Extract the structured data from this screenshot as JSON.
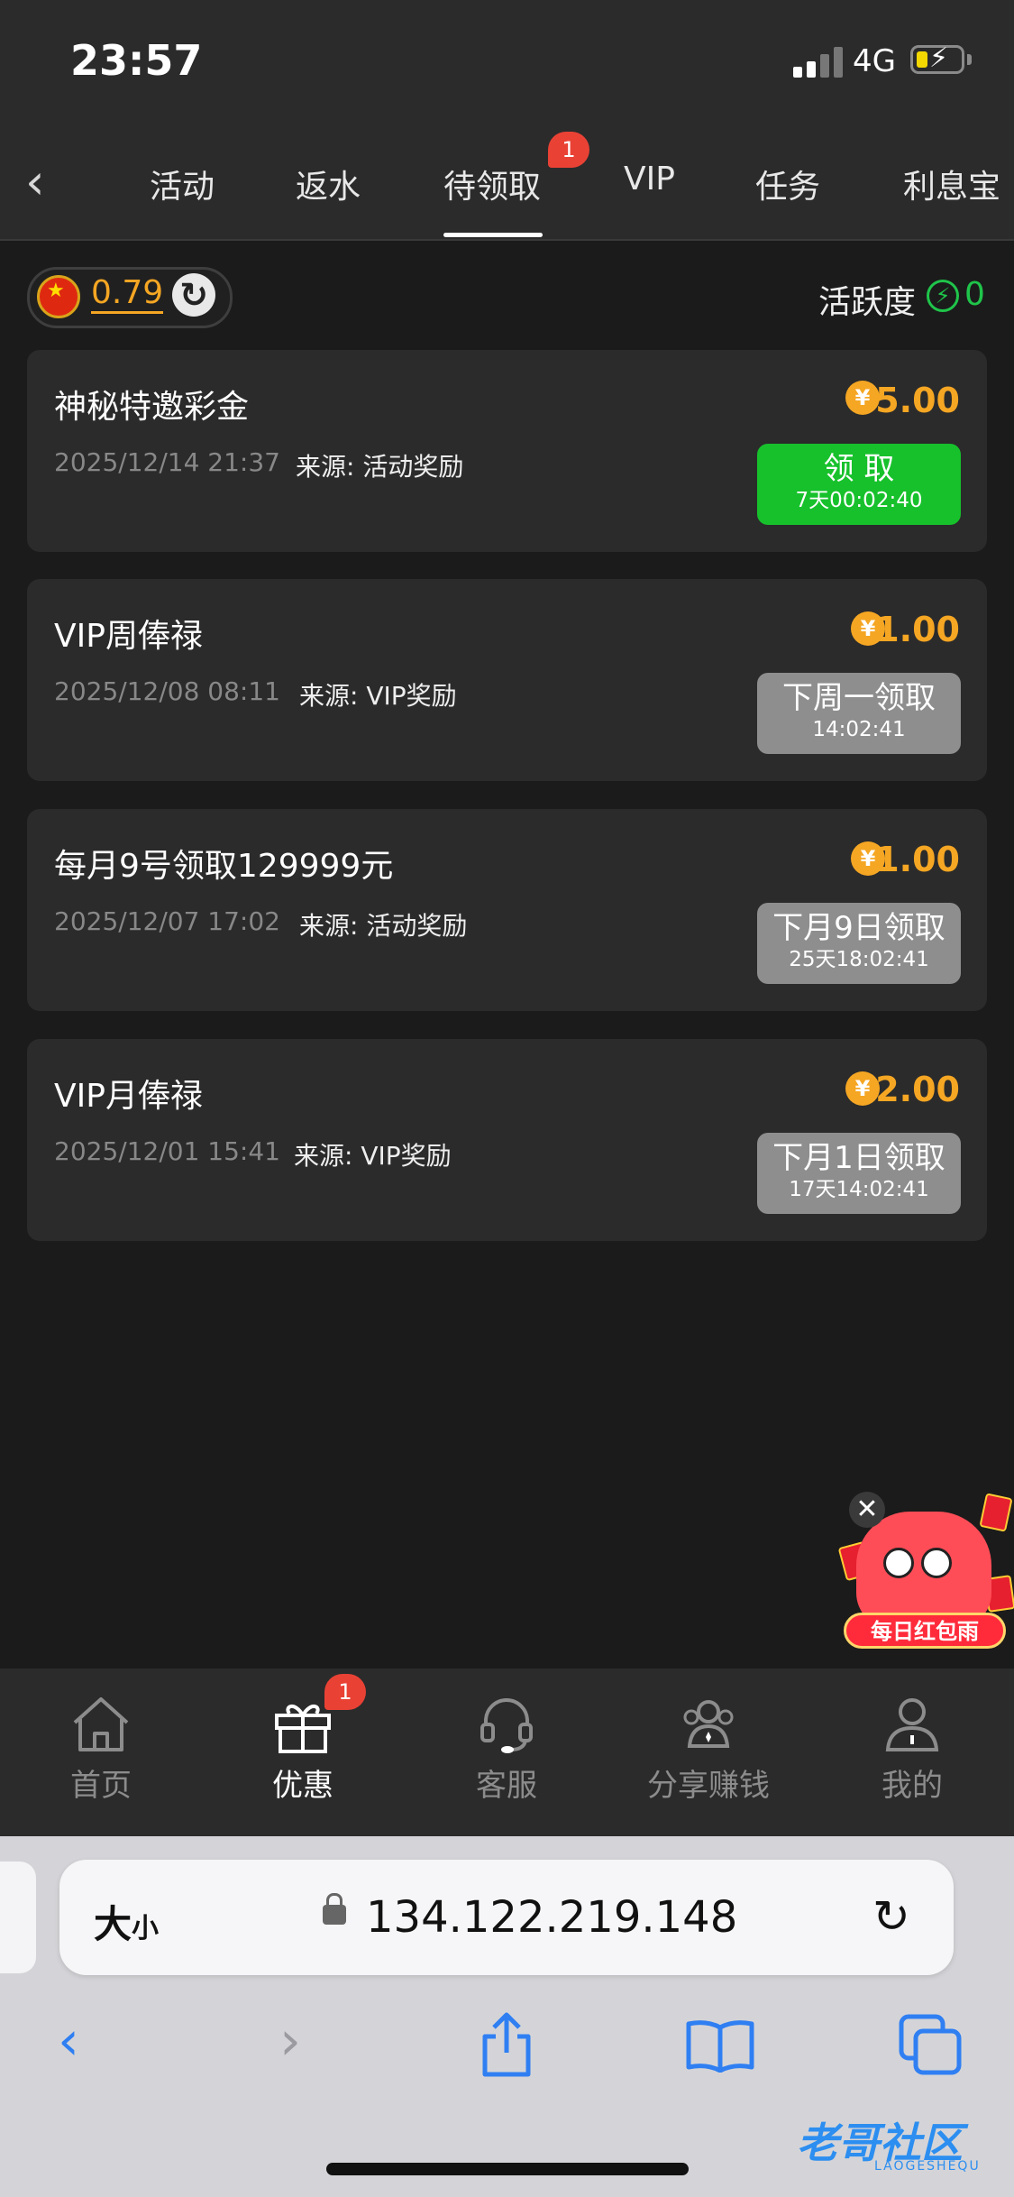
{
  "status": {
    "time": "23:57",
    "network": "4G"
  },
  "tabs": [
    {
      "label": "活动"
    },
    {
      "label": "返水"
    },
    {
      "label": "待领取",
      "badge": "1",
      "active": true
    },
    {
      "label": "VIP"
    },
    {
      "label": "任务"
    },
    {
      "label": "利息宝"
    }
  ],
  "balance": {
    "value": "0.79"
  },
  "activity": {
    "label": "活跃度",
    "value": "0"
  },
  "rewards": [
    {
      "title": "神秘特邀彩金",
      "date": "2025/12/14 21:37",
      "source": "来源: 活动奖励",
      "coin": "¥",
      "amount": "5.00",
      "button_label": "领 取",
      "button_sub": "7天00:02:40",
      "button_state": "active",
      "button_color": "#17c12c"
    },
    {
      "title": "VIP周俸禄",
      "date": "2025/12/08 08:11",
      "source": "来源: VIP奖励",
      "coin": "¥",
      "amount": "1.00",
      "button_label": "下周一领取",
      "button_sub": "14:02:41",
      "button_state": "disabled",
      "button_color": "#8e8e8e"
    },
    {
      "title": "每月9号领取129999元",
      "date": "2025/12/07 17:02",
      "source": "来源: 活动奖励",
      "coin": "¥",
      "amount": "1.00",
      "button_label": "下月9日领取",
      "button_sub": "25天18:02:41",
      "button_state": "disabled",
      "button_color": "#8e8e8e"
    },
    {
      "title": "VIP月俸禄",
      "date": "2025/12/01 15:41",
      "source": "来源: VIP奖励",
      "coin": "¥",
      "amount": "2.00",
      "button_label": "下月1日领取",
      "button_sub": "17天14:02:41",
      "button_state": "disabled",
      "button_color": "#8e8e8e"
    }
  ],
  "float_ad": {
    "label": "每日红包雨",
    "close": "✕"
  },
  "bottom_nav": {
    "items": [
      {
        "label": "首页",
        "icon": "home-icon"
      },
      {
        "label": "优惠",
        "icon": "gift-icon",
        "active": true,
        "badge": "1"
      },
      {
        "label": "客服",
        "icon": "headset-icon"
      },
      {
        "label": "分享赚钱",
        "icon": "share-people-icon"
      },
      {
        "label": "我的",
        "icon": "user-icon"
      }
    ]
  },
  "browser": {
    "text_size_big": "大",
    "text_size_small": "小",
    "url": "134.122.219.148"
  },
  "watermark": {
    "text": "老哥社区",
    "sub": "LAOGESHEQU"
  },
  "colors": {
    "accent": "#f5a623",
    "green": "#17c12c",
    "badge": "#e94235",
    "ios_blue": "#2f7ff2"
  }
}
